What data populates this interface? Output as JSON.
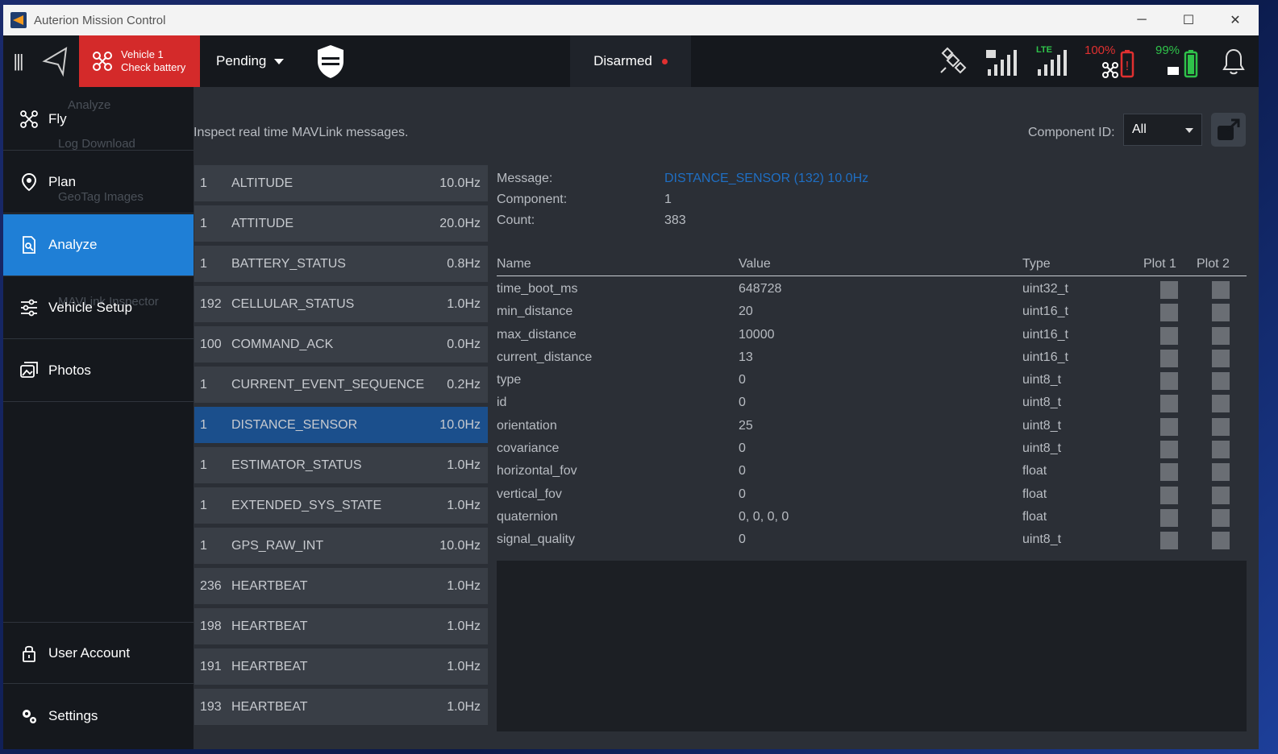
{
  "window": {
    "title": "Auterion Mission Control",
    "controls": {
      "minimize": "─",
      "maximize": "☐",
      "close": "✕"
    }
  },
  "toolbar": {
    "vehicle_line1": "Vehicle 1",
    "vehicle_line2": "Check battery",
    "pending": "Pending",
    "armed": "Disarmed",
    "lte": "LTE",
    "vehicle_battery": "100%",
    "controller_battery": "99%"
  },
  "sidebar": {
    "items": [
      {
        "label": "Fly",
        "icon": "drone-icon"
      },
      {
        "label": "Plan",
        "icon": "map-pin-icon"
      },
      {
        "label": "Analyze",
        "icon": "analyze-icon",
        "active": true
      },
      {
        "label": "Vehicle Setup",
        "icon": "sliders-icon"
      },
      {
        "label": "Photos",
        "icon": "photos-icon"
      },
      {
        "label": "User Account",
        "icon": "lock-icon"
      },
      {
        "label": "Settings",
        "icon": "gear-icon"
      }
    ],
    "ghost": [
      "Analyze",
      "Log Download",
      "GeoTag Images",
      "MAVLink Inspector"
    ]
  },
  "main": {
    "description": "Inspect real time MAVLink messages.",
    "component_label": "Component ID:",
    "component_value": "All"
  },
  "messages": [
    {
      "cid": "1",
      "name": "ALTITUDE",
      "hz": "10.0Hz"
    },
    {
      "cid": "1",
      "name": "ATTITUDE",
      "hz": "20.0Hz"
    },
    {
      "cid": "1",
      "name": "BATTERY_STATUS",
      "hz": "0.8Hz"
    },
    {
      "cid": "192",
      "name": "CELLULAR_STATUS",
      "hz": "1.0Hz"
    },
    {
      "cid": "100",
      "name": "COMMAND_ACK",
      "hz": "0.0Hz"
    },
    {
      "cid": "1",
      "name": "CURRENT_EVENT_SEQUENCE",
      "hz": "0.2Hz"
    },
    {
      "cid": "1",
      "name": "DISTANCE_SENSOR",
      "hz": "10.0Hz",
      "selected": true
    },
    {
      "cid": "1",
      "name": "ESTIMATOR_STATUS",
      "hz": "1.0Hz"
    },
    {
      "cid": "1",
      "name": "EXTENDED_SYS_STATE",
      "hz": "1.0Hz"
    },
    {
      "cid": "1",
      "name": "GPS_RAW_INT",
      "hz": "10.0Hz"
    },
    {
      "cid": "236",
      "name": "HEARTBEAT",
      "hz": "1.0Hz"
    },
    {
      "cid": "198",
      "name": "HEARTBEAT",
      "hz": "1.0Hz"
    },
    {
      "cid": "191",
      "name": "HEARTBEAT",
      "hz": "1.0Hz"
    },
    {
      "cid": "193",
      "name": "HEARTBEAT",
      "hz": "1.0Hz"
    }
  ],
  "detail": {
    "message_label": "Message:",
    "message_value": "DISTANCE_SENSOR (132) 10.0Hz",
    "component_label": "Component:",
    "component_value": "1",
    "count_label": "Count:",
    "count_value": "383",
    "headers": {
      "name": "Name",
      "value": "Value",
      "type": "Type",
      "plot1": "Plot 1",
      "plot2": "Plot 2"
    },
    "fields": [
      {
        "name": "time_boot_ms",
        "value": "648728",
        "type": "uint32_t"
      },
      {
        "name": "min_distance",
        "value": "20",
        "type": "uint16_t"
      },
      {
        "name": "max_distance",
        "value": "10000",
        "type": "uint16_t"
      },
      {
        "name": "current_distance",
        "value": "13",
        "type": "uint16_t"
      },
      {
        "name": "type",
        "value": "0",
        "type": "uint8_t"
      },
      {
        "name": "id",
        "value": "0",
        "type": "uint8_t"
      },
      {
        "name": "orientation",
        "value": "25",
        "type": "uint8_t"
      },
      {
        "name": "covariance",
        "value": "0",
        "type": "uint8_t"
      },
      {
        "name": "horizontal_fov",
        "value": "0",
        "type": "float"
      },
      {
        "name": "vertical_fov",
        "value": "0",
        "type": "float"
      },
      {
        "name": "quaternion",
        "value": "0, 0, 0, 0",
        "type": "float"
      },
      {
        "name": "signal_quality",
        "value": "0",
        "type": "uint8_t"
      }
    ]
  },
  "colors": {
    "accent": "#1f7fd6",
    "alert": "#d42a2a",
    "ok": "#2fc24a",
    "selected_row": "#1b4f8c"
  }
}
